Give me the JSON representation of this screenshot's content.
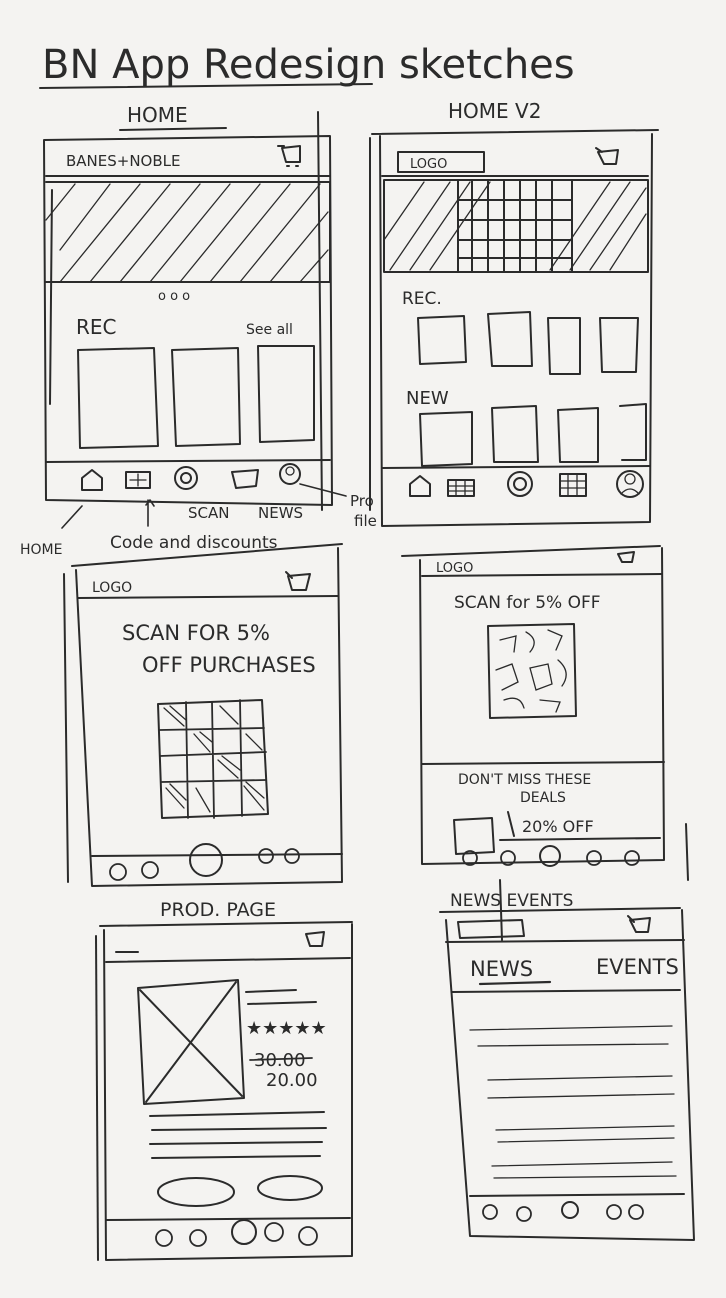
{
  "page_title": "BN App Redesign sketches",
  "frames": {
    "home": {
      "caption": "HOME",
      "header_logo": "BANES+NOBLE",
      "section_label": "REC",
      "see_all": "See all",
      "carousel_dots": "o o o"
    },
    "home_v2": {
      "caption": "HOME V2",
      "header_logo": "LOGO",
      "section_rec": "REC.",
      "section_new": "NEW"
    },
    "scan_a": {
      "header_logo": "LOGO",
      "headline_line1": "SCAN FOR 5%",
      "headline_line2": "OFF PURCHASES"
    },
    "scan_b": {
      "header_logo": "LOGO",
      "headline": "SCAN for 5% OFF",
      "deals_line1": "DON'T MISS THESE",
      "deals_line2": "DEALS",
      "deal_text": "20% OFF"
    },
    "product": {
      "caption": "PROD. PAGE",
      "rating_stars": "★★★★★",
      "price_old": "30.00",
      "price_new": "20.00"
    },
    "news_events": {
      "caption": "NEWS EVENTS",
      "tab_news": "NEWS",
      "tab_events": "EVENTS"
    }
  },
  "annotations": {
    "home": "HOME",
    "codes": "Code and discounts",
    "scan": "SCAN",
    "news": "NEWS",
    "profile_line1": "Pro",
    "profile_line2": "file"
  },
  "icons": {
    "cart": "cart-icon",
    "home": "home-icon",
    "coupon": "coupon-icon",
    "scan": "scan-icon",
    "news": "news-icon",
    "profile": "profile-icon",
    "calendar": "calendar-icon"
  }
}
